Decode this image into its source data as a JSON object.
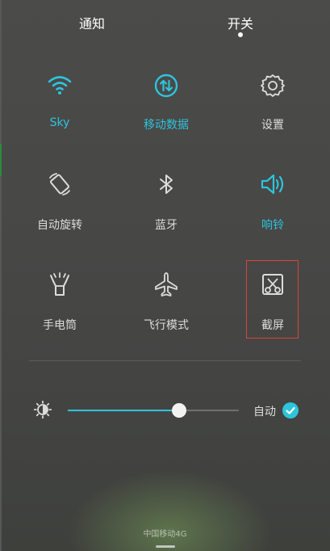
{
  "tabs": {
    "notifications": "通知",
    "toggles": "开关",
    "selected": "toggles"
  },
  "tiles": [
    {
      "label": "Sky",
      "icon": "wifi-icon",
      "active": true
    },
    {
      "label": "移动数据",
      "icon": "mobile-data-icon",
      "active": true
    },
    {
      "label": "设置",
      "icon": "gear-icon",
      "active": false
    },
    {
      "label": "自动旋转",
      "icon": "auto-rotate-icon",
      "active": false
    },
    {
      "label": "蓝牙",
      "icon": "bluetooth-icon",
      "active": false
    },
    {
      "label": "响铃",
      "icon": "speaker-icon",
      "active": true
    },
    {
      "label": "手电筒",
      "icon": "flashlight-icon",
      "active": false
    },
    {
      "label": "飞行模式",
      "icon": "airplane-icon",
      "active": false
    },
    {
      "label": "截屏",
      "icon": "screenshot-icon",
      "active": false
    }
  ],
  "brightness": {
    "level_percent": 65,
    "auto_label": "自动",
    "auto_enabled": true
  },
  "carrier": "中国移动4G",
  "colors": {
    "accent": "#2ec4dc",
    "inactive": "#dcdcdc",
    "highlight_box": "#d9453c"
  }
}
